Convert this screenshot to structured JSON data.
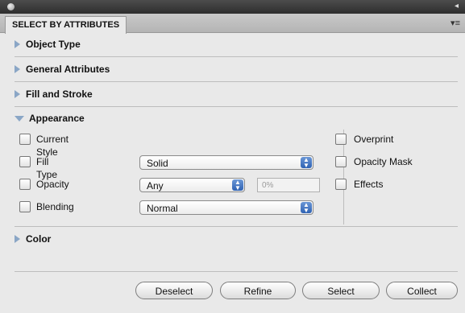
{
  "panel": {
    "tab_label": "SELECT BY ATTRIBUTES",
    "menu_glyph": "▾≡"
  },
  "sections": {
    "object_type": "Object Type",
    "general_attributes": "General Attributes",
    "fill_and_stroke": "Fill and Stroke",
    "appearance": "Appearance",
    "color": "Color"
  },
  "appearance": {
    "left": [
      {
        "label": "Current Style"
      },
      {
        "label": "Fill Type"
      },
      {
        "label": "Opacity"
      },
      {
        "label": "Blending"
      }
    ],
    "fill_type_value": "Solid",
    "opacity_value": "Any",
    "opacity_percent": "0%",
    "blending_value": "Normal",
    "right": [
      {
        "label": "Overprint"
      },
      {
        "label": "Opacity Mask"
      },
      {
        "label": "Effects"
      }
    ]
  },
  "buttons": {
    "deselect": "Deselect",
    "refine": "Refine",
    "select": "Select",
    "collect": "Collect"
  },
  "icons": {
    "collapsed": "triangle-right-icon",
    "expanded": "triangle-down-icon",
    "select_arrow": "updown-arrows-icon"
  }
}
